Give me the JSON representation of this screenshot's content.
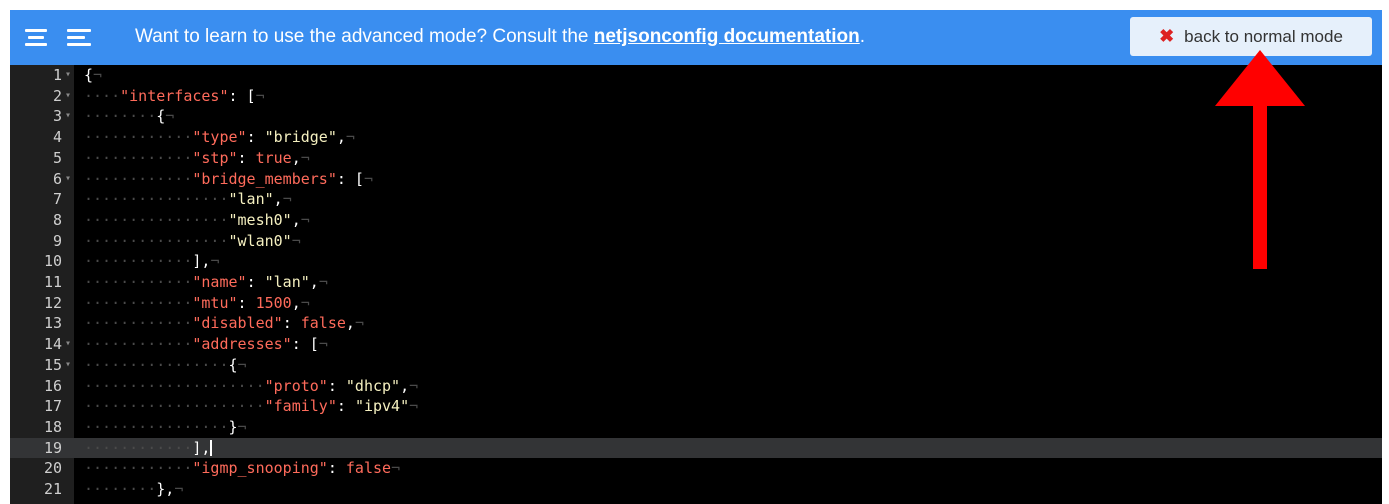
{
  "topbar": {
    "message_before": "Want to learn to use the advanced mode? Consult the ",
    "doc_link": "netjsonconfig documentation",
    "message_after": ".",
    "back_button_icon": "close-icon",
    "back_button_label": "back to normal mode",
    "icons": [
      "hamburger-icon",
      "menu-lines-icon"
    ],
    "bar_color": "#3a8ef0",
    "button_color": "#e6f0fb"
  },
  "editor": {
    "active_line": 19,
    "lines": [
      {
        "n": "1",
        "fold": true,
        "indent": 0,
        "tokens": [
          [
            "p",
            "{"
          ]
        ]
      },
      {
        "n": "2",
        "fold": true,
        "indent": 1,
        "tokens": [
          [
            "k",
            "\"interfaces\""
          ],
          [
            "p",
            ": ["
          ]
        ]
      },
      {
        "n": "3",
        "fold": true,
        "indent": 2,
        "tokens": [
          [
            "p",
            "{"
          ]
        ]
      },
      {
        "n": "4",
        "fold": false,
        "indent": 3,
        "tokens": [
          [
            "k",
            "\"type\""
          ],
          [
            "p",
            ": "
          ],
          [
            "s",
            "\"bridge\""
          ],
          [
            "p",
            ","
          ]
        ]
      },
      {
        "n": "5",
        "fold": false,
        "indent": 3,
        "tokens": [
          [
            "k",
            "\"stp\""
          ],
          [
            "p",
            ": "
          ],
          [
            "b",
            "true"
          ],
          [
            "p",
            ","
          ]
        ]
      },
      {
        "n": "6",
        "fold": true,
        "indent": 3,
        "tokens": [
          [
            "k",
            "\"bridge_members\""
          ],
          [
            "p",
            ": ["
          ]
        ]
      },
      {
        "n": "7",
        "fold": false,
        "indent": 4,
        "tokens": [
          [
            "s",
            "\"lan\""
          ],
          [
            "p",
            ","
          ]
        ]
      },
      {
        "n": "8",
        "fold": false,
        "indent": 4,
        "tokens": [
          [
            "s",
            "\"mesh0\""
          ],
          [
            "p",
            ","
          ]
        ]
      },
      {
        "n": "9",
        "fold": false,
        "indent": 4,
        "tokens": [
          [
            "s",
            "\"wlan0\""
          ]
        ]
      },
      {
        "n": "10",
        "fold": false,
        "indent": 3,
        "tokens": [
          [
            "p",
            "],"
          ]
        ]
      },
      {
        "n": "11",
        "fold": false,
        "indent": 3,
        "tokens": [
          [
            "k",
            "\"name\""
          ],
          [
            "p",
            ": "
          ],
          [
            "s",
            "\"lan\""
          ],
          [
            "p",
            ","
          ]
        ]
      },
      {
        "n": "12",
        "fold": false,
        "indent": 3,
        "tokens": [
          [
            "k",
            "\"mtu\""
          ],
          [
            "p",
            ": "
          ],
          [
            "n",
            "1500"
          ],
          [
            "p",
            ","
          ]
        ]
      },
      {
        "n": "13",
        "fold": false,
        "indent": 3,
        "tokens": [
          [
            "k",
            "\"disabled\""
          ],
          [
            "p",
            ": "
          ],
          [
            "b",
            "false"
          ],
          [
            "p",
            ","
          ]
        ]
      },
      {
        "n": "14",
        "fold": true,
        "indent": 3,
        "tokens": [
          [
            "k",
            "\"addresses\""
          ],
          [
            "p",
            ": ["
          ]
        ]
      },
      {
        "n": "15",
        "fold": true,
        "indent": 4,
        "tokens": [
          [
            "p",
            "{"
          ]
        ]
      },
      {
        "n": "16",
        "fold": false,
        "indent": 5,
        "tokens": [
          [
            "k",
            "\"proto\""
          ],
          [
            "p",
            ": "
          ],
          [
            "s",
            "\"dhcp\""
          ],
          [
            "p",
            ","
          ]
        ]
      },
      {
        "n": "17",
        "fold": false,
        "indent": 5,
        "tokens": [
          [
            "k",
            "\"family\""
          ],
          [
            "p",
            ": "
          ],
          [
            "s",
            "\"ipv4\""
          ]
        ]
      },
      {
        "n": "18",
        "fold": false,
        "indent": 4,
        "tokens": [
          [
            "p",
            "}"
          ]
        ]
      },
      {
        "n": "19",
        "fold": false,
        "indent": 3,
        "tokens": [
          [
            "p",
            "],"
          ]
        ],
        "cursor": true
      },
      {
        "n": "20",
        "fold": false,
        "indent": 3,
        "tokens": [
          [
            "k",
            "\"igmp_snooping\""
          ],
          [
            "p",
            ": "
          ],
          [
            "b",
            "false"
          ]
        ]
      },
      {
        "n": "21",
        "fold": false,
        "indent": 2,
        "tokens": [
          [
            "p",
            "},"
          ]
        ]
      }
    ]
  },
  "annotation": {
    "arrow_color": "#ff0000",
    "arrow_direction": "up"
  }
}
